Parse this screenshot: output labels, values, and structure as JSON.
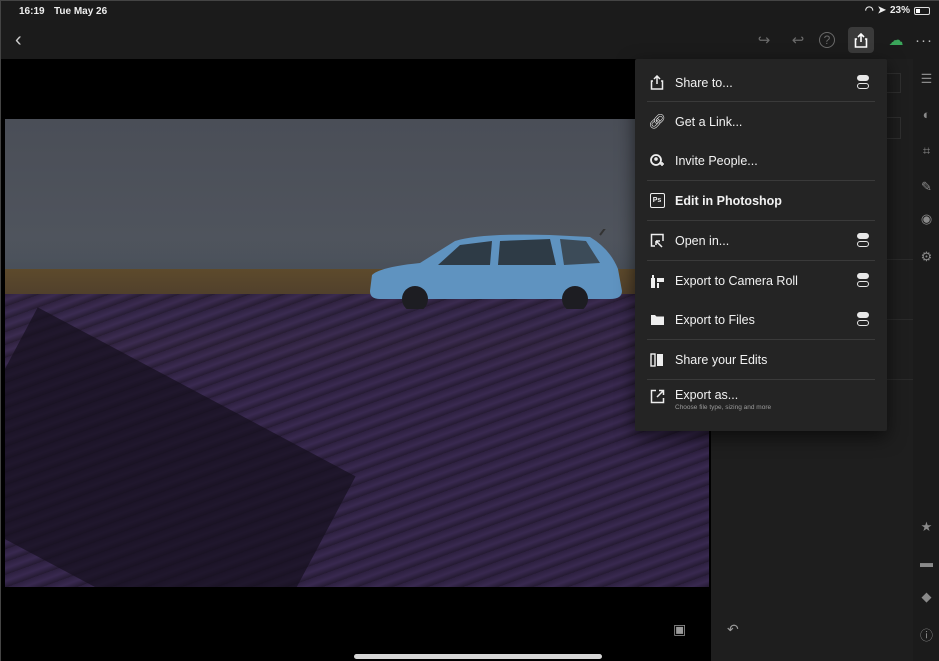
{
  "status_bar": {
    "time": "16:19",
    "date": "Tue May 26",
    "battery": "23%"
  },
  "toolbar": {
    "back_icon": "chevron-left",
    "redo_icon": "redo",
    "undo_icon": "undo",
    "help_icon": "question-circle",
    "share_icon": "share-up",
    "cloud_icon": "cloud-synced",
    "more_icon": "ellipsis",
    "accent": "#3aa55a"
  },
  "share_menu": {
    "items": [
      {
        "label": "Share to...",
        "icon": "share-up",
        "toggle": true
      },
      {
        "label": "Get a Link...",
        "icon": "link",
        "toggle": false
      },
      {
        "label": "Invite People...",
        "icon": "person-add",
        "toggle": false
      },
      {
        "label": "Edit in Photoshop",
        "icon": "photoshop",
        "toggle": false
      },
      {
        "label": "Open in...",
        "icon": "open-in",
        "toggle": true
      },
      {
        "label": "Export to Camera Roll",
        "icon": "camera-roll",
        "toggle": true
      },
      {
        "label": "Export to Files",
        "icon": "folder",
        "toggle": true
      },
      {
        "label": "Share your Edits",
        "icon": "compare",
        "toggle": false
      },
      {
        "label": "Export as...",
        "sublabel": "Choose file type, sizing and more",
        "icon": "export-as",
        "toggle": false
      }
    ]
  },
  "tool_rail": {
    "icons": [
      "sliders-icon",
      "mask-icon",
      "crop-icon",
      "brush-icon",
      "geometry-icon",
      "presets-icon",
      "star-icon",
      "comment-icon",
      "tag-icon",
      "info-icon"
    ]
  }
}
